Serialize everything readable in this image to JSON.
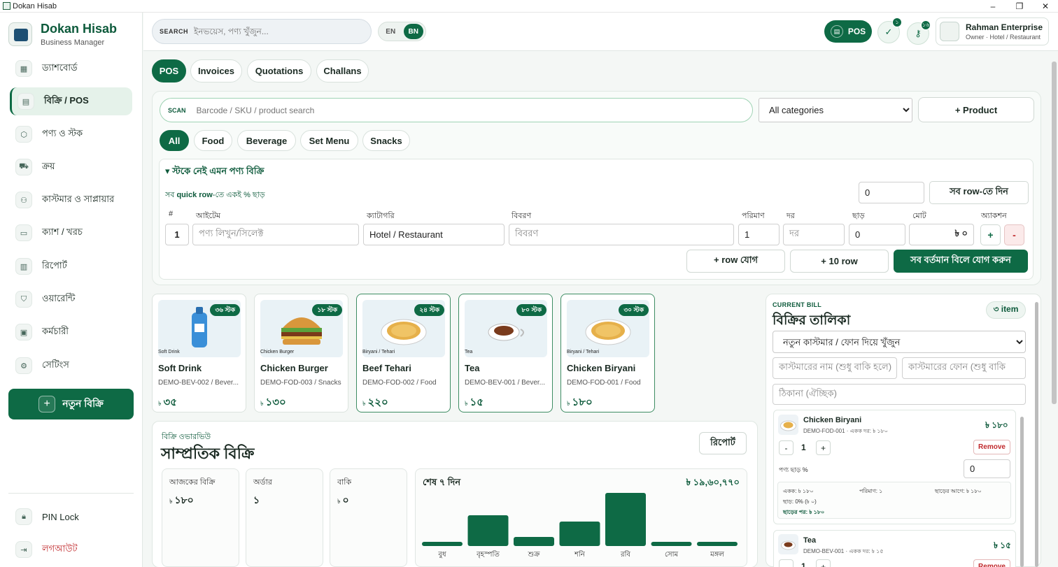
{
  "window": {
    "title": "Dokan Hisab",
    "controls": [
      "–",
      "❐",
      "✕"
    ]
  },
  "brand": {
    "name": "Dokan Hisab",
    "subtitle": "Business Manager"
  },
  "sidebar": {
    "items": [
      {
        "label": "ড্যাশবোর্ড",
        "icon": "dashboard-icon",
        "glyph": "▦"
      },
      {
        "label": "বিক্রি / POS",
        "icon": "receipt-icon",
        "glyph": "▤"
      },
      {
        "label": "পণ্য ও স্টক",
        "icon": "box-icon",
        "glyph": "⬡"
      },
      {
        "label": "ক্রয়",
        "icon": "truck-icon",
        "glyph": "⛟"
      },
      {
        "label": "কাস্টমার ও সাপ্লায়ার",
        "icon": "users-icon",
        "glyph": "⚇"
      },
      {
        "label": "ক্যাশ / খরচ",
        "icon": "wallet-icon",
        "glyph": "▭"
      },
      {
        "label": "রিপোর্ট",
        "icon": "bar-chart-icon",
        "glyph": "▥"
      },
      {
        "label": "ওয়ারেন্টি",
        "icon": "shield-icon",
        "glyph": "⛉"
      },
      {
        "label": "কর্মচারী",
        "icon": "calendar-icon",
        "glyph": "▣"
      },
      {
        "label": "সেটিংস",
        "icon": "gear-icon",
        "glyph": "⚙"
      }
    ],
    "active_index": 1,
    "new_sale": "নতুন বিক্রি",
    "pin_lock": "PIN Lock",
    "logout": "লগআউট"
  },
  "header": {
    "search_label": "SEARCH",
    "search_placeholder": "ইনভয়েস, পণ্য খুঁজুন...",
    "lang_en": "EN",
    "lang_bn": "BN",
    "pos_label": "POS",
    "badge_check": "১",
    "badge_key": "১৬",
    "business_name": "Rahman Enterprise",
    "business_role": "Owner · Hotel / Restaurant"
  },
  "tabs": [
    "POS",
    "Invoices",
    "Quotations",
    "Challans"
  ],
  "pos": {
    "scan_label": "SCAN",
    "scan_placeholder": "Barcode / SKU / product search",
    "category_select": "All categories",
    "add_product": "+ Product",
    "chips": [
      "All",
      "Food",
      "Beverage",
      "Set Menu",
      "Snacks"
    ]
  },
  "quick": {
    "title": "▾ স্টকে নেই এমন পণ্য বিক্রি",
    "sub_pre": "সব ",
    "sub_bold": "quick row",
    "sub_post": "-তে একই % ছাড়",
    "bulk_discount": "0",
    "apply_all": "সব row-তে দিন",
    "headers": [
      "#",
      "আইটেম",
      "ক্যাটাগরি",
      "বিবরণ",
      "পরিমাণ",
      "দর",
      "ছাড়",
      "মোট",
      "অ্যাকশন"
    ],
    "row": {
      "num": "1",
      "item_placeholder": "পণ্য লিখুন/সিলেক্ট",
      "category": "Hotel / Restaurant",
      "desc_placeholder": "বিবরণ",
      "qty": "1",
      "rate_placeholder": "দর",
      "discount": "0",
      "total": "৳ ০",
      "add": "+",
      "remove": "-"
    },
    "add_row": "+ row যোগ",
    "add_10": "+ 10 row",
    "add_all": "সব বর্তমান বিলে যোগ করুন"
  },
  "products": [
    {
      "name": "Soft Drink",
      "sku": "DEMO-BEV-002 / Bever...",
      "price": "৩৫",
      "stock": "৩৬ স্টক",
      "caption": "Soft Drink",
      "art": "bottle",
      "selected": false
    },
    {
      "name": "Chicken Burger",
      "sku": "DEMO-FOD-003 / Snacks",
      "price": "১৩০",
      "stock": "১৮ স্টক",
      "caption": "Chicken Burger",
      "art": "burger",
      "selected": false
    },
    {
      "name": "Beef Tehari",
      "sku": "DEMO-FOD-002 / Food",
      "price": "২২০",
      "stock": "২৪ স্টক",
      "caption": "Biryani / Tehari",
      "art": "plate",
      "selected": true
    },
    {
      "name": "Tea",
      "sku": "DEMO-BEV-001 / Bever...",
      "price": "১৫",
      "stock": "৮০ স্টক",
      "caption": "Tea",
      "art": "tea",
      "selected": true
    },
    {
      "name": "Chicken Biryani",
      "sku": "DEMO-FOD-001 / Food",
      "price": "১৮০",
      "stock": "৩০ স্টক",
      "caption": "Biryani / Tehari",
      "art": "plate",
      "selected": true
    }
  ],
  "currency": "৳",
  "overview": {
    "kicker": "বিক্রি ওভারভিউ",
    "title": "সাম্প্রতিক বিক্রি",
    "report_btn": "রিপোর্ট",
    "stats": [
      {
        "label": "আজকের বিক্রি",
        "value": "১৮০",
        "currency": true
      },
      {
        "label": "অর্ডার",
        "value": "১",
        "currency": false
      },
      {
        "label": "বাকি",
        "value": "০",
        "currency": true
      }
    ]
  },
  "chart_data": {
    "type": "bar",
    "title": "শেষ ৭ দিন",
    "total": "৳ ১৯,৬০,৭৭০",
    "categories": [
      "বুধ",
      "বৃহস্পতি",
      "শুক্র",
      "শনি",
      "রবি",
      "সোম",
      "মঙ্গল"
    ],
    "values": [
      6,
      44,
      13,
      35,
      76,
      6,
      6
    ],
    "ylim": [
      0,
      80
    ],
    "color": "#0e6a45"
  },
  "bill": {
    "kicker": "CURRENT BILL",
    "title": "বিক্রির তালিকা",
    "count": "৩ item",
    "customer_select": "নতুন কাস্টমার / ফোন দিয়ে খুঁজুন",
    "name_placeholder": "কাস্টমারের নাম (শুধু বাকি হলে)",
    "phone_placeholder": "কাস্টমারের ফোন (শুধু বাকি",
    "address_placeholder": "ঠিকানা (ঐচ্ছিক)",
    "items": [
      {
        "name": "Chicken Biryani",
        "meta": "DEMO-FOD-001 · একক দর: ৳ ১৮০",
        "price": "৳ ১৮০",
        "qty": "1",
        "remove": "Remove",
        "disc_label": "পণ্য ছাড় %",
        "disc": "0",
        "unit": "একক: ৳ ১৮০",
        "amount": "পরিমাণ: ১",
        "before": "ছাড়ের আগে: ৳ ১৮০",
        "disc_line": "ছাড়: 0% (৳ ০)",
        "after": "ছাড়ের পর: ৳ ১৮০"
      },
      {
        "name": "Tea",
        "meta": "DEMO-BEV-001 · একক দর: ৳ ১৫",
        "price": "৳ ১৫",
        "qty": "1",
        "remove": "Remove"
      }
    ]
  }
}
